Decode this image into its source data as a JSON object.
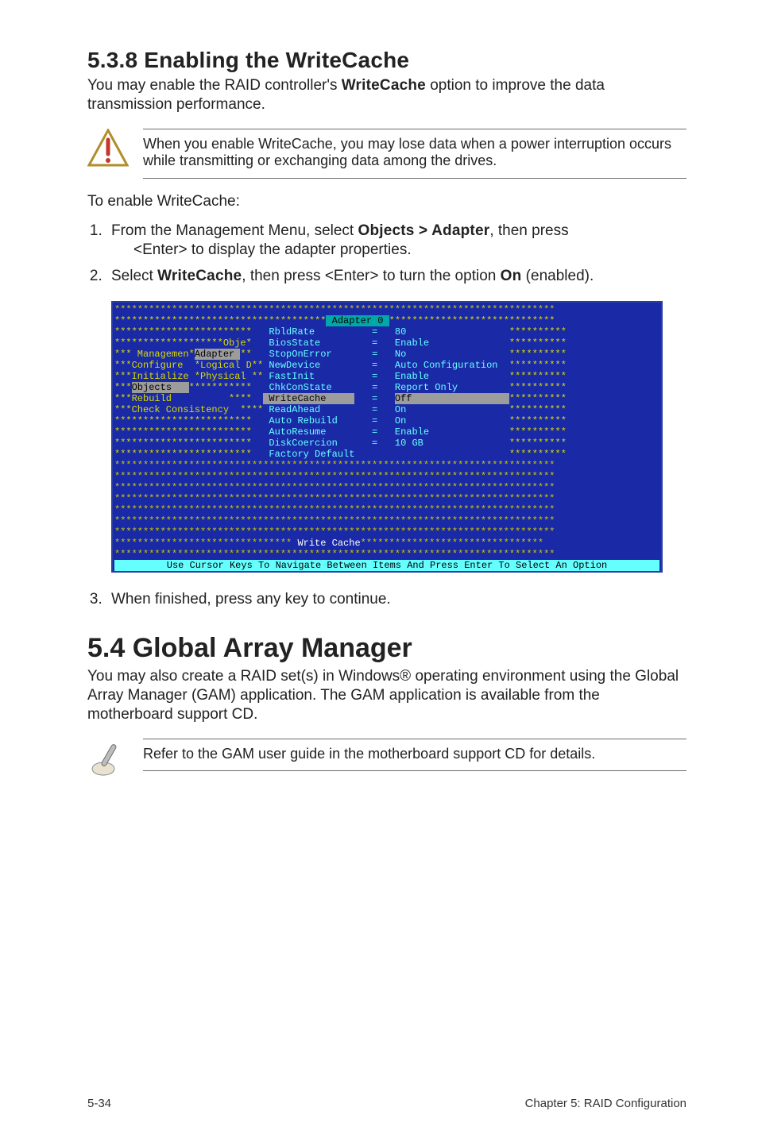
{
  "section": {
    "number_title": "5.3.8 Enabling the WriteCache",
    "intro_pre": "You may enable the RAID controller's ",
    "intro_bold": "WriteCache",
    "intro_post": " option to improve the data transmission performance."
  },
  "warning": {
    "icon_name": "warning-icon",
    "text": "When you enable WriteCache, you may lose data when a power interruption occurs while transmitting or exchanging data among the drives."
  },
  "steps_intro": "To enable WriteCache:",
  "steps": [
    {
      "pre": "From the Management Menu, select ",
      "b1": "Objects > Adapter",
      "mid": ", then press",
      "line2": "<Enter> to display the adapter properties."
    },
    {
      "pre": "Select ",
      "b1": "WriteCache",
      "mid": ", then press <Enter> to turn the option ",
      "b2": "On",
      "post": " (enabled)."
    }
  ],
  "terminal": {
    "header_title": " Adapter 0 ",
    "rows": [
      {
        "left": "************************",
        "key": " RbldRate",
        "eq": "=",
        "val": "80",
        "right": "**********"
      },
      {
        "left": "*******************Obje*",
        "key": " BiosState",
        "eq": "=",
        "val": "Enable",
        "right": "**********"
      },
      {
        "left": "*** Managemen*",
        "grey": "Adapter ",
        "left2": "**",
        "key": " StopOnError",
        "eq": "=",
        "val": "No",
        "right": "**********"
      },
      {
        "left": "***Configure  *Logical D**",
        "key": " NewDevice",
        "eq": "=",
        "val": "Auto Configuration",
        "right": "**********"
      },
      {
        "left": "***Initialize *Physical **",
        "key": " FastInit",
        "eq": "=",
        "val": "Enable",
        "right": "**********"
      },
      {
        "left": "***",
        "grey": "Objects   ",
        "left2": "***********",
        "key": " ChkConState",
        "eq": "=",
        "val": "Report Only",
        "right": "**********"
      },
      {
        "left": "***Rebuild          ****",
        "inv": true,
        "key": " WriteCache",
        "eq": "=",
        "valinv": "Off",
        "right": "**********"
      },
      {
        "left": "***Check Consistency  ****",
        "key": " ReadAhead",
        "eq": "=",
        "val": "On",
        "right": "**********"
      },
      {
        "left": "************************",
        "key": " Auto Rebuild",
        "eq": "=",
        "val": "On",
        "right": "**********"
      },
      {
        "left": "************************",
        "key": " AutoResume",
        "eq": "=",
        "val": "Enable",
        "right": "**********"
      },
      {
        "left": "************************",
        "key": " DiskCoercion",
        "eq": "=",
        "val": "10 GB",
        "right": "**********"
      },
      {
        "left": "************************",
        "key": " Factory Default",
        "eq": " ",
        "val": " ",
        "right": "**********"
      }
    ],
    "fill_row": "*****************************************************************************",
    "write_cache_row_pre": "******************************* ",
    "write_cache_label": "Write Cache",
    "write_cache_row_post": "********************************",
    "footer": " Use Cursor Keys To Navigate Between Items And Press Enter To Select An Option "
  },
  "after_step": "When finished, press any key to continue.",
  "section2": {
    "title": "5.4 Global Array Manager",
    "para": "You may also create a RAID set(s) in Windows® operating environment using the Global Array Manager (GAM) application. The GAM application is available from the motherboard support CD."
  },
  "note": {
    "icon_name": "note-icon",
    "text": "Refer to the GAM user guide in the motherboard support CD for details."
  },
  "footer": {
    "left": "5-34",
    "right": "Chapter 5: RAID Configuration"
  }
}
